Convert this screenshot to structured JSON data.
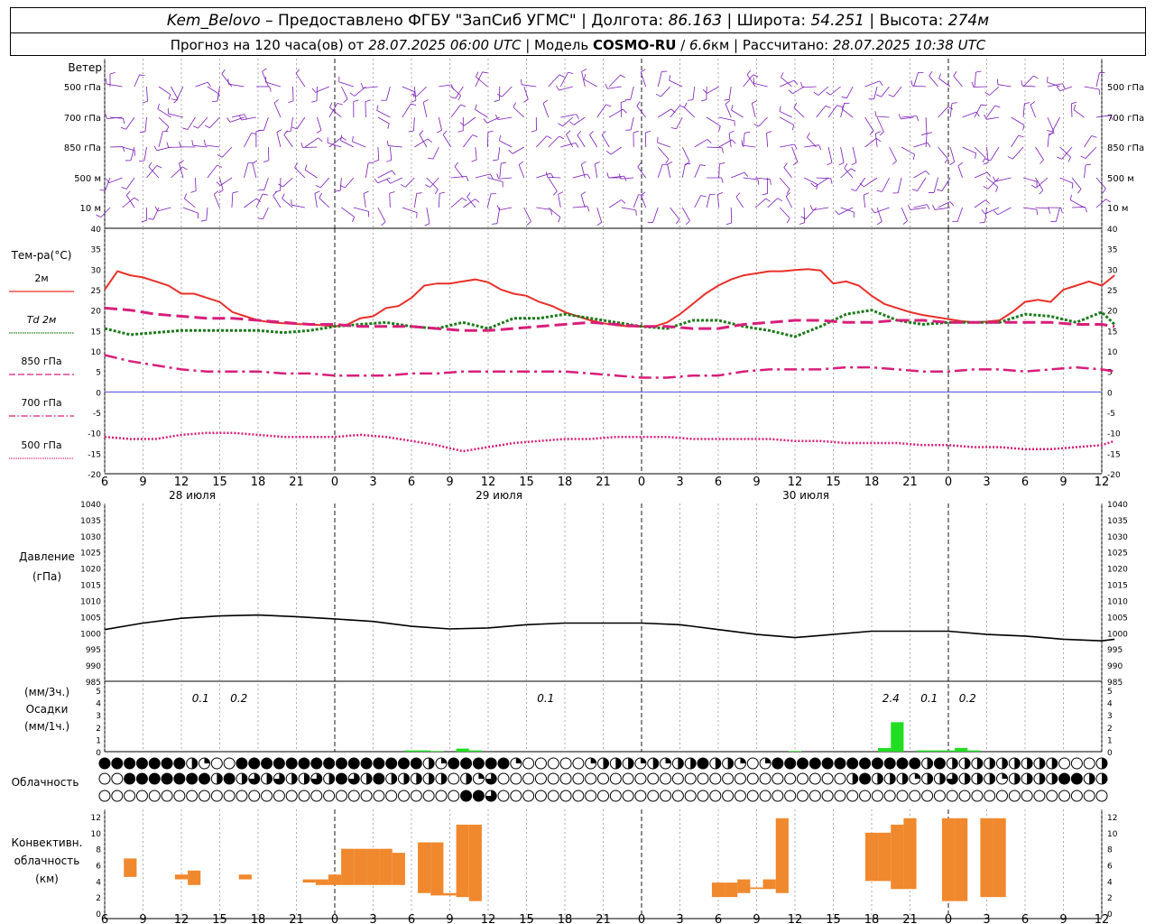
{
  "header": {
    "station": "Kem_Belovo",
    "provider": " – Предоставлено ФГБУ \"ЗапСиб УГМС\" | Долгота: ",
    "lon": "86.163",
    "sep_lat": " | Широта: ",
    "lat": "54.251",
    "sep_alt": " | Высота: ",
    "alt": "274м",
    "line2_a": "Прогноз на 120 часа(ов) от ",
    "run_time": "28.07.2025 06:00 UTC",
    "line2_b": " | Модель ",
    "model": "COSMO-RU",
    "line2_c": " / ",
    "resolution": "6.6",
    "line2_d": "км | Рассчитано: ",
    "calc_time": "28.07.2025 10:38 UTC"
  },
  "time_axis": {
    "hour_labels": [
      "6",
      "9",
      "12",
      "15",
      "18",
      "21",
      "0",
      "3",
      "6",
      "9",
      "12",
      "15",
      "18",
      "21",
      "0",
      "3",
      "6",
      "9",
      "12",
      "15",
      "18",
      "21",
      "0",
      "3",
      "6",
      "9",
      "12"
    ],
    "date_labels": [
      "28 июля",
      "29 июля",
      "30 июля"
    ]
  },
  "wind": {
    "title": "Ветер",
    "levels": [
      "500 гПа",
      "700 гПа",
      "850 гПа",
      "500 м",
      "10 м"
    ]
  },
  "temperature": {
    "title": "Тем-ра(°C)",
    "legend": [
      "2м",
      "Td  2м",
      "850 гПа",
      "700 гПа",
      "500 гПа"
    ],
    "legend_colors": [
      "#e8302a",
      "#1a7a1a",
      "#d81e7a",
      "#d81e7a",
      "#d81e7a"
    ]
  },
  "pressure": {
    "title_1": "Давление",
    "title_2": "(гПа)"
  },
  "precip": {
    "title_1": "(мм/3ч.)",
    "title_2": "Осадки",
    "title_3": "(мм/1ч.)",
    "labels": [
      {
        "hour": 7.5,
        "text": "0.1"
      },
      {
        "hour": 10.5,
        "text": "0.2"
      },
      {
        "hour": 34.5,
        "text": "0.1"
      },
      {
        "hour": 61.5,
        "text": "2.4"
      },
      {
        "hour": 64.5,
        "text": "0.1"
      },
      {
        "hour": 67.5,
        "text": "0.2"
      }
    ]
  },
  "cloud": {
    "title": "Облачность"
  },
  "convective": {
    "title_1": "Конвективн.",
    "title_2": "облачность",
    "title_3": "(км)"
  },
  "colors": {
    "temp_2m": "#e8302a",
    "dewpoint": "#1a7a1a",
    "upper": "#d81e7a",
    "zero_line": "#4a4adb",
    "wind": "#7a1ab8",
    "precip_bar": "#22dd22",
    "convective_bar": "#f0882e"
  },
  "chart_data": [
    {
      "type": "line",
      "title": "Тем-ра(°C)",
      "x_unit": "hours since 28.07.2025 06:00 UTC",
      "ylim": [
        -20,
        40
      ],
      "y_ticks": [
        -20,
        -15,
        -10,
        -5,
        0,
        5,
        10,
        15,
        20,
        25,
        30,
        35,
        40
      ],
      "series": [
        {
          "name": "2м",
          "x": [
            0,
            1,
            2,
            3,
            4,
            5,
            6,
            7,
            8,
            9,
            10,
            11,
            12,
            13,
            14,
            15,
            16,
            17,
            18,
            19,
            20,
            21,
            22,
            23,
            24,
            25,
            26,
            27,
            28,
            29,
            30,
            31,
            32,
            33,
            34,
            35,
            36,
            37,
            38,
            39,
            40,
            41,
            42,
            43,
            44,
            45,
            46,
            47,
            48,
            49,
            50,
            51,
            52,
            53,
            54,
            55,
            56,
            57,
            58,
            59,
            60,
            61,
            62,
            63,
            64,
            65,
            66,
            67,
            68,
            69,
            70,
            71,
            72,
            73,
            74,
            75,
            76,
            77,
            78,
            79
          ],
          "y": [
            25,
            29.5,
            28.5,
            28,
            27,
            26,
            24,
            24,
            23,
            22,
            19.5,
            18.5,
            17.5,
            17,
            16.8,
            16.6,
            16.5,
            16.3,
            16,
            16.5,
            18,
            18.5,
            20.5,
            21,
            23,
            26,
            26.5,
            26.5,
            27,
            27.5,
            26.8,
            25,
            24,
            23.5,
            22,
            21,
            19.5,
            18.5,
            17.5,
            16.8,
            16.3,
            16,
            16,
            16,
            17,
            19,
            21.5,
            24,
            26,
            27.5,
            28.5,
            29,
            29.5,
            29.5,
            29.8,
            30,
            29.7,
            26.5,
            27,
            26,
            23.5,
            21.5,
            20.5,
            19.5,
            18.8,
            18.3,
            17.8,
            17.3,
            17,
            17.2,
            17.5,
            19.5,
            22,
            22.5,
            22,
            25,
            26,
            27,
            26,
            28.5
          ]
        },
        {
          "name": "Td  2м",
          "x": [
            0,
            2,
            4,
            6,
            8,
            10,
            12,
            14,
            16,
            18,
            20,
            22,
            24,
            26,
            28,
            30,
            32,
            34,
            36,
            38,
            40,
            42,
            44,
            46,
            48,
            50,
            52,
            54,
            56,
            58,
            60,
            62,
            64,
            66,
            68,
            70,
            72,
            74,
            76,
            78,
            79
          ],
          "y": [
            15.5,
            14,
            14.5,
            15,
            15,
            15,
            15,
            14.5,
            15,
            16,
            16.5,
            17,
            16,
            15.5,
            17,
            15.5,
            18,
            18,
            19,
            18,
            17,
            16,
            15.5,
            17.5,
            17.5,
            16,
            15,
            13.5,
            16,
            19,
            20,
            17.5,
            16.5,
            17,
            17,
            17,
            19,
            18.5,
            17,
            19.5,
            16.5
          ]
        },
        {
          "name": "850 гПа",
          "x": [
            0,
            2,
            4,
            6,
            8,
            10,
            12,
            14,
            16,
            18,
            20,
            22,
            24,
            26,
            28,
            30,
            32,
            34,
            36,
            38,
            40,
            42,
            44,
            46,
            48,
            50,
            52,
            54,
            56,
            58,
            60,
            62,
            64,
            66,
            68,
            70,
            72,
            74,
            76,
            78,
            79
          ],
          "y": [
            20.5,
            20,
            19,
            18.5,
            18,
            18,
            17.5,
            17,
            16.5,
            16.5,
            16,
            16,
            16,
            15.5,
            15,
            15,
            15.5,
            16,
            16.5,
            17,
            16.5,
            16,
            16,
            15.5,
            15.5,
            16.5,
            17,
            17.5,
            17.5,
            17,
            17,
            17.5,
            17.5,
            17,
            17,
            17,
            17,
            17,
            16.5,
            16.5,
            16
          ]
        },
        {
          "name": "700 гПа",
          "x": [
            0,
            2,
            4,
            6,
            8,
            10,
            12,
            14,
            16,
            18,
            20,
            22,
            24,
            26,
            28,
            30,
            32,
            34,
            36,
            38,
            40,
            42,
            44,
            46,
            48,
            50,
            52,
            54,
            56,
            58,
            60,
            62,
            64,
            66,
            68,
            70,
            72,
            74,
            76,
            78,
            79
          ],
          "y": [
            9,
            7.5,
            6.5,
            5.5,
            5,
            5,
            5,
            4.5,
            4.5,
            4,
            4,
            4,
            4.5,
            4.5,
            5,
            5,
            5,
            5,
            5,
            4.5,
            4,
            3.5,
            3.5,
            4,
            4,
            5,
            5.5,
            5.5,
            5.5,
            6,
            6,
            5.5,
            5,
            5,
            5.5,
            5.5,
            5,
            5.5,
            6,
            5.5,
            5
          ]
        },
        {
          "name": "500 гПа",
          "x": [
            0,
            2,
            4,
            6,
            8,
            10,
            12,
            14,
            16,
            18,
            20,
            22,
            24,
            26,
            28,
            30,
            32,
            34,
            36,
            38,
            40,
            42,
            44,
            46,
            48,
            50,
            52,
            54,
            56,
            58,
            60,
            62,
            64,
            66,
            68,
            70,
            72,
            74,
            76,
            78,
            79
          ],
          "y": [
            -11,
            -11.5,
            -11.5,
            -10.5,
            -10,
            -10,
            -10.5,
            -11,
            -11,
            -11,
            -10.5,
            -11,
            -12,
            -13,
            -14.5,
            -13.5,
            -12.5,
            -12,
            -11.5,
            -11.5,
            -11,
            -11,
            -11,
            -11.5,
            -11.5,
            -11.5,
            -11.5,
            -12,
            -12,
            -12.5,
            -12.5,
            -12.5,
            -13,
            -13,
            -13.5,
            -13.5,
            -14,
            -14,
            -13.5,
            -13,
            -12
          ]
        }
      ]
    },
    {
      "type": "line",
      "title": "Давление (гПа)",
      "x_unit": "hours since 28.07.2025 06:00 UTC",
      "ylim": [
        985,
        1040
      ],
      "y_ticks": [
        985,
        990,
        995,
        1000,
        1005,
        1010,
        1015,
        1020,
        1025,
        1030,
        1035,
        1040
      ],
      "series": [
        {
          "name": "pressure",
          "x": [
            0,
            3,
            6,
            9,
            12,
            15,
            18,
            21,
            24,
            27,
            30,
            33,
            36,
            39,
            42,
            45,
            48,
            51,
            54,
            57,
            60,
            63,
            66,
            69,
            72,
            75,
            78,
            79
          ],
          "y": [
            1001,
            1003,
            1004.5,
            1005.2,
            1005.5,
            1005,
            1004.3,
            1003.5,
            1002,
            1001.2,
            1001.5,
            1002.5,
            1003,
            1003,
            1003,
            1002.5,
            1001,
            999.5,
            998.5,
            999.5,
            1000.5,
            1000.5,
            1000.5,
            999.5,
            999,
            998,
            997.5,
            998
          ]
        }
      ]
    },
    {
      "type": "bar",
      "title": "Осадки",
      "x_unit": "hours since 28.07.2025 06:00 UTC",
      "ylim": [
        0,
        5
      ],
      "y_ticks": [
        0,
        1,
        2,
        3,
        4,
        5
      ],
      "series": [
        {
          "name": "мм/1ч.",
          "x": [
            24,
            25,
            26,
            28,
            29,
            54,
            61,
            62,
            64,
            65,
            66,
            67,
            68
          ],
          "y": [
            0.1,
            0.1,
            0.05,
            0.25,
            0.1,
            0.05,
            0.3,
            2.4,
            0.1,
            0.1,
            0.1,
            0.3,
            0.1
          ]
        }
      ]
    },
    {
      "type": "bar",
      "title": "Конвективн. облачность (км)",
      "x_unit": "hours since 28.07.2025 06:00 UTC",
      "ylim": [
        0,
        12
      ],
      "y_ticks": [
        0,
        2,
        4,
        6,
        8,
        10,
        12
      ],
      "bars": [
        {
          "x": 2,
          "base": 4.5,
          "top": 6.8
        },
        {
          "x": 6,
          "base": 4.2,
          "top": 4.8
        },
        {
          "x": 7,
          "base": 3.5,
          "top": 5.3
        },
        {
          "x": 11,
          "base": 4.2,
          "top": 4.8
        },
        {
          "x": 16,
          "base": 3.8,
          "top": 4.2
        },
        {
          "x": 17,
          "base": 3.5,
          "top": 4.2
        },
        {
          "x": 18,
          "base": 3.5,
          "top": 4.8
        },
        {
          "x": 19,
          "base": 3.5,
          "top": 8
        },
        {
          "x": 20,
          "base": 3.5,
          "top": 8
        },
        {
          "x": 21,
          "base": 3.5,
          "top": 8
        },
        {
          "x": 22,
          "base": 3.5,
          "top": 8
        },
        {
          "x": 23,
          "base": 3.5,
          "top": 7.5
        },
        {
          "x": 25,
          "base": 2.5,
          "top": 8.8
        },
        {
          "x": 26,
          "base": 2.2,
          "top": 8.8
        },
        {
          "x": 27,
          "base": 2.2,
          "top": 2.5
        },
        {
          "x": 28,
          "base": 2,
          "top": 11
        },
        {
          "x": 29,
          "base": 1.5,
          "top": 11
        },
        {
          "x": 48,
          "base": 2,
          "top": 3.8
        },
        {
          "x": 49,
          "base": 2,
          "top": 3.8
        },
        {
          "x": 50,
          "base": 2.5,
          "top": 4.2
        },
        {
          "x": 51,
          "base": 3,
          "top": 3.2
        },
        {
          "x": 52,
          "base": 3,
          "top": 4.2
        },
        {
          "x": 53,
          "base": 2.5,
          "top": 11.8
        },
        {
          "x": 60,
          "base": 4,
          "top": 10
        },
        {
          "x": 61,
          "base": 4,
          "top": 10
        },
        {
          "x": 62,
          "base": 3,
          "top": 11
        },
        {
          "x": 63,
          "base": 3,
          "top": 11.8
        },
        {
          "x": 66,
          "base": 1.5,
          "top": 11.8
        },
        {
          "x": 67,
          "base": 1.5,
          "top": 11.8
        },
        {
          "x": 69,
          "base": 2,
          "top": 11.8
        },
        {
          "x": 70,
          "base": 2,
          "top": 11.8
        }
      ]
    }
  ]
}
